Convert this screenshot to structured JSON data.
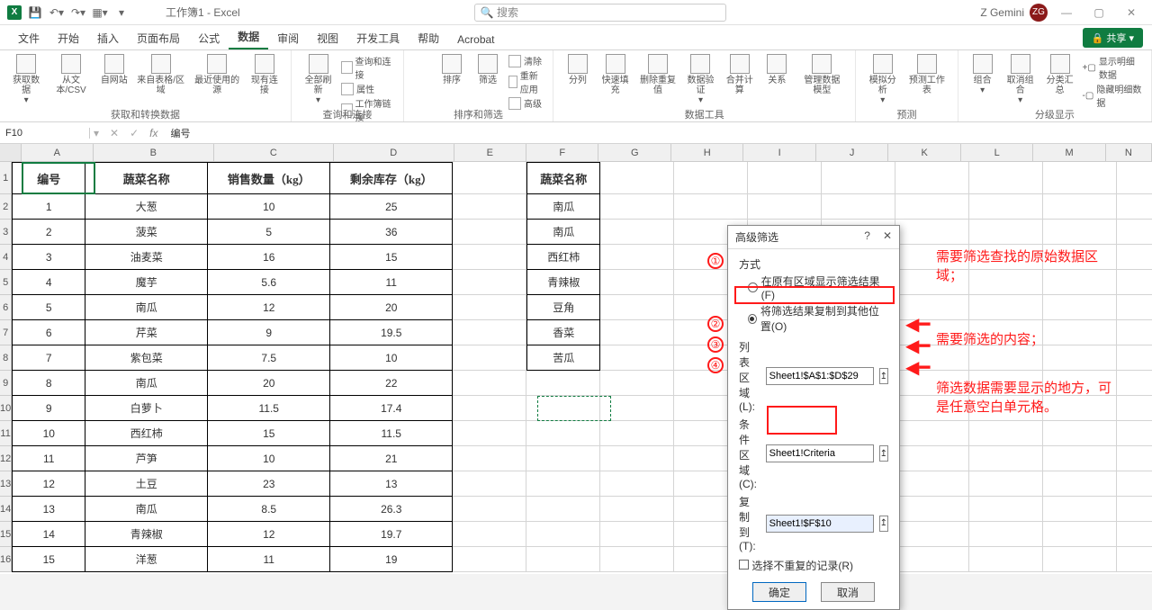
{
  "title": "工作簿1 - Excel",
  "search_placeholder": "搜索",
  "user": {
    "name": "Z Gemini",
    "initials": "ZG"
  },
  "tabs": [
    "文件",
    "开始",
    "插入",
    "页面布局",
    "公式",
    "数据",
    "审阅",
    "视图",
    "开发工具",
    "帮助",
    "Acrobat"
  ],
  "active_tab": "数据",
  "share": "共享",
  "ribbon_groups": {
    "g1": {
      "label": "获取和转换数据",
      "items": [
        "获取数据",
        "从文本/CSV",
        "自网站",
        "来自表格/区域",
        "最近使用的源",
        "现有连接"
      ]
    },
    "g2": {
      "label": "查询和连接",
      "main": "全部刷新",
      "side": [
        "查询和连接",
        "属性",
        "工作簿链接"
      ]
    },
    "g3": {
      "label": "排序和筛选",
      "items": [
        "排序",
        "筛选"
      ],
      "side": [
        "清除",
        "重新应用",
        "高级"
      ]
    },
    "g4": {
      "label": "数据工具",
      "items": [
        "分列",
        "快速填充",
        "删除重复值",
        "数据验证",
        "合并计算",
        "关系",
        "管理数据模型"
      ]
    },
    "g5": {
      "label": "预测",
      "items": [
        "模拟分析",
        "预测工作表"
      ]
    },
    "g6": {
      "label": "分级显示",
      "items": [
        "组合",
        "取消组合",
        "分类汇总"
      ],
      "side": [
        "显示明细数据",
        "隐藏明细数据"
      ]
    }
  },
  "namebox": "F10",
  "formula": "编号",
  "columns": [
    "A",
    "B",
    "C",
    "D",
    "E",
    "F",
    "G",
    "H",
    "I",
    "J",
    "K",
    "L",
    "M",
    "N"
  ],
  "table": {
    "headers": [
      "编号",
      "蔬菜名称",
      "销售数量（kg）",
      "剩余库存（kg）"
    ],
    "rows": [
      [
        "1",
        "大葱",
        "10",
        "25"
      ],
      [
        "2",
        "菠菜",
        "5",
        "36"
      ],
      [
        "3",
        "油麦菜",
        "16",
        "15"
      ],
      [
        "4",
        "魔芋",
        "5.6",
        "11"
      ],
      [
        "5",
        "南瓜",
        "12",
        "20"
      ],
      [
        "6",
        "芹菜",
        "9",
        "19.5"
      ],
      [
        "7",
        "紫包菜",
        "7.5",
        "10"
      ],
      [
        "8",
        "南瓜",
        "20",
        "22"
      ],
      [
        "9",
        "白萝卜",
        "11.5",
        "17.4"
      ],
      [
        "10",
        "西红柿",
        "15",
        "11.5"
      ],
      [
        "11",
        "芦笋",
        "10",
        "21"
      ],
      [
        "12",
        "土豆",
        "23",
        "13"
      ],
      [
        "13",
        "南瓜",
        "8.5",
        "26.3"
      ],
      [
        "14",
        "青辣椒",
        "12",
        "19.7"
      ],
      [
        "15",
        "洋葱",
        "11",
        "19"
      ]
    ]
  },
  "side_table": {
    "header": "蔬菜名称",
    "rows": [
      "南瓜",
      "南瓜",
      "西红柿",
      "青辣椒",
      "豆角",
      "香菜",
      "苦瓜"
    ]
  },
  "dialog": {
    "title": "高级筛选",
    "method_label": "方式",
    "radio1": "在原有区域显示筛选结果(F)",
    "radio2": "将筛选结果复制到其他位置(O)",
    "list_label": "列表区域(L):",
    "list_val": "Sheet1!$A$1:$D$29",
    "crit_label": "条件区域(C):",
    "crit_val": "Sheet1!Criteria",
    "copy_label": "复制到(T):",
    "copy_val": "Sheet1!$F$10",
    "unique": "选择不重复的记录(R)",
    "ok": "确定",
    "cancel": "取消"
  },
  "annotations": {
    "a1": "需要筛选查找的原始数据区域；",
    "a2": "需要筛选的内容；",
    "a3": "筛选数据需要显示的地方，可是任意空白单元格。"
  }
}
